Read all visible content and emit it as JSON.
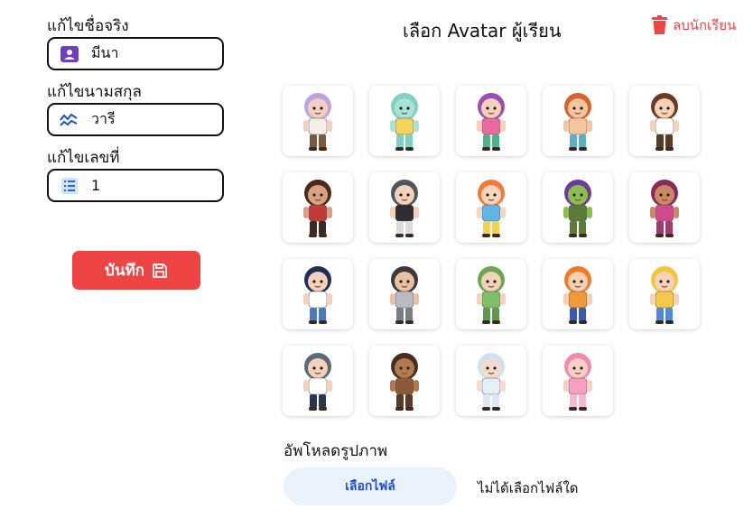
{
  "form": {
    "first_name": {
      "label": "แก้ไขชื่อจริง",
      "value": "มีนา",
      "icon": "person-badge-icon"
    },
    "last_name": {
      "label": "แก้ไขนามสกุล",
      "value": "วารี",
      "icon": "signature-icon"
    },
    "number": {
      "label": "แก้ไขเลขที่",
      "value": "1",
      "icon": "list-icon"
    },
    "save_label": "บันทึก"
  },
  "header": {
    "title": "เลือก Avatar ผู้เรียน",
    "delete_label": "ลบนักเรียน"
  },
  "avatars": [
    {
      "hair": "#b9a6e0",
      "skin": "#f3cfc0",
      "top": "#f5f0e6",
      "bottom": "#7a5a3a"
    },
    {
      "hair": "#7fd1c3",
      "skin": "#a8e3d6",
      "top": "#f3d35c",
      "bottom": "#7fd1c3"
    },
    {
      "hair": "#9b4fb3",
      "skin": "#f6d1b8",
      "top": "#e86aa0",
      "bottom": "#4fb38a"
    },
    {
      "hair": "#d8622e",
      "skin": "#f3c6a0",
      "top": "#f3c6a0",
      "bottom": "#5ab0c8"
    },
    {
      "hair": "#6b3b24",
      "skin": "#f4d2b6",
      "top": "#ffffff",
      "bottom": "#5a3a22"
    },
    {
      "hair": "#4a2a1a",
      "skin": "#d9a27f",
      "top": "#c23b3b",
      "bottom": "#3b2a22"
    },
    {
      "hair": "#4a5660",
      "skin": "#f3d2b9",
      "top": "#2e2e33",
      "bottom": "#dcdcdc"
    },
    {
      "hair": "#f07a3a",
      "skin": "#f7d6bd",
      "top": "#5fb6e6",
      "bottom": "#f5d24d"
    },
    {
      "hair": "#6c3c9c",
      "skin": "#8bbf4a",
      "top": "#5c7a3a",
      "bottom": "#5c7a3a"
    },
    {
      "hair": "#8a2a5a",
      "skin": "#c98a62",
      "top": "#d14a8c",
      "bottom": "#a33a6e"
    },
    {
      "hair": "#1f2f5a",
      "skin": "#f3d2b9",
      "top": "#ffffff",
      "bottom": "#4a7ac0"
    },
    {
      "hair": "#3a3a3a",
      "skin": "#e8c2a0",
      "top": "#b8bcc2",
      "bottom": "#7a7e84"
    },
    {
      "hair": "#6aa84f",
      "skin": "#f3d2b9",
      "top": "#7fbf6a",
      "bottom": "#5f9a4a"
    },
    {
      "hair": "#f07a2a",
      "skin": "#f6d0b2",
      "top": "#f09a3a",
      "bottom": "#3a5ab0"
    },
    {
      "hair": "#f2c63a",
      "skin": "#f6d3b8",
      "top": "#f5c84a",
      "bottom": "#4f8ad8"
    },
    {
      "hair": "#5a6a7a",
      "skin": "#f3d2b9",
      "top": "#ffffff",
      "bottom": "#2a3550"
    },
    {
      "hair": "#4a2e1e",
      "skin": "#b37a52",
      "top": "#8a5a3a",
      "bottom": "#5a3a26"
    },
    {
      "hair": "#cfe0ef",
      "skin": "#f6dccc",
      "top": "#e6eef8",
      "bottom": "#dce8f5"
    },
    {
      "hair": "#f08ab0",
      "skin": "#f6d0c0",
      "top": "#f5a0c0",
      "bottom": "#f5b8cc"
    }
  ],
  "upload": {
    "label": "อัพโหลดรูปภาพ",
    "button": "เลือกไฟล์",
    "status": "ไม่ได้เลือกไฟล์ใด"
  },
  "colors": {
    "accent_red": "#ef4444",
    "accent_blue": "#1d4ed8",
    "icon_purple": "#6d3fc0"
  }
}
